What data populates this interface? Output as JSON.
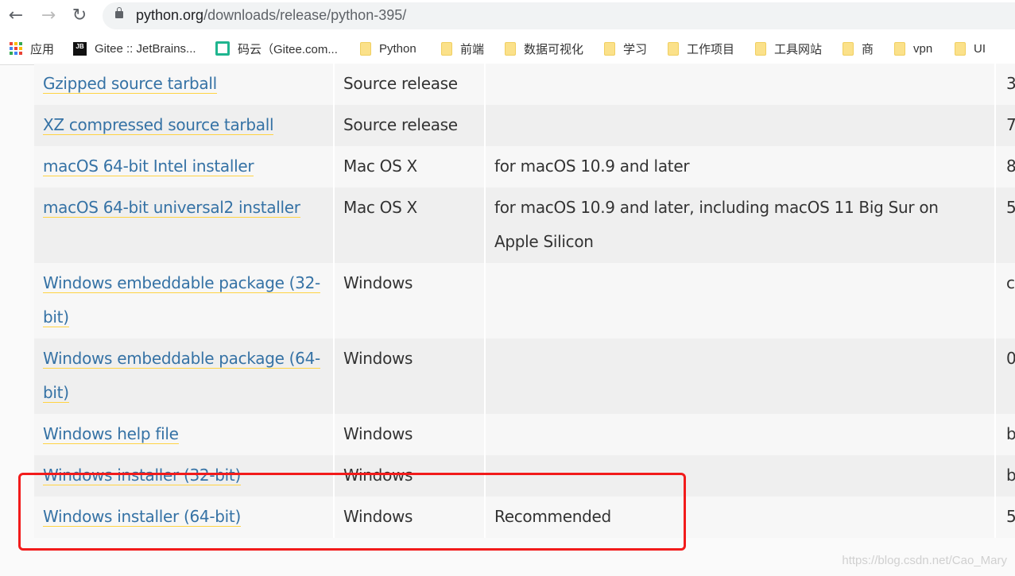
{
  "browser": {
    "url_host": "python.org",
    "url_path": "/downloads/release/python-395/"
  },
  "bookmarks": [
    {
      "label": "应用",
      "icon": "apps-grid-icon"
    },
    {
      "label": "Gitee :: JetBrains...",
      "icon": "jetbrains-icon"
    },
    {
      "label": "码云（Gitee.com...",
      "icon": "gitee-icon"
    },
    {
      "label": "Python",
      "icon": "folder-icon"
    },
    {
      "label": "前端",
      "icon": "folder-icon"
    },
    {
      "label": "数据可视化",
      "icon": "folder-icon"
    },
    {
      "label": "学习",
      "icon": "folder-icon"
    },
    {
      "label": "工作项目",
      "icon": "folder-icon"
    },
    {
      "label": "工具网站",
      "icon": "folder-icon"
    },
    {
      "label": "商",
      "icon": "folder-icon"
    },
    {
      "label": "vpn",
      "icon": "folder-icon"
    },
    {
      "label": "UI",
      "icon": "folder-icon"
    }
  ],
  "rows": [
    {
      "version": "Gzipped source tarball",
      "os": "Source release",
      "desc": "",
      "md5": "3"
    },
    {
      "version": "XZ compressed source tarball",
      "os": "Source release",
      "desc": "",
      "md5": "7"
    },
    {
      "version": "macOS 64-bit Intel installer",
      "os": "Mac OS X",
      "desc": "for macOS 10.9 and later",
      "md5": "8"
    },
    {
      "version": "macOS 64-bit universal2 installer",
      "os": "Mac OS X",
      "desc": "for macOS 10.9 and later, including macOS 11 Big Sur on Apple Silicon",
      "md5": "5"
    },
    {
      "version": "Windows embeddable package (32-bit)",
      "os": "Windows",
      "desc": "",
      "md5": "ca"
    },
    {
      "version": "Windows embeddable package (64-bit)",
      "os": "Windows",
      "desc": "",
      "md5": "0"
    },
    {
      "version": "Windows help file",
      "os": "Windows",
      "desc": "",
      "md5": "b"
    },
    {
      "version": "Windows installer (32-bit)",
      "os": "Windows",
      "desc": "",
      "md5": "b"
    },
    {
      "version": "Windows installer (64-bit)",
      "os": "Windows",
      "desc": "Recommended",
      "md5": "5"
    }
  ],
  "highlight_color": "#f21b1b",
  "watermark": "https://blog.csdn.net/Cao_Mary"
}
